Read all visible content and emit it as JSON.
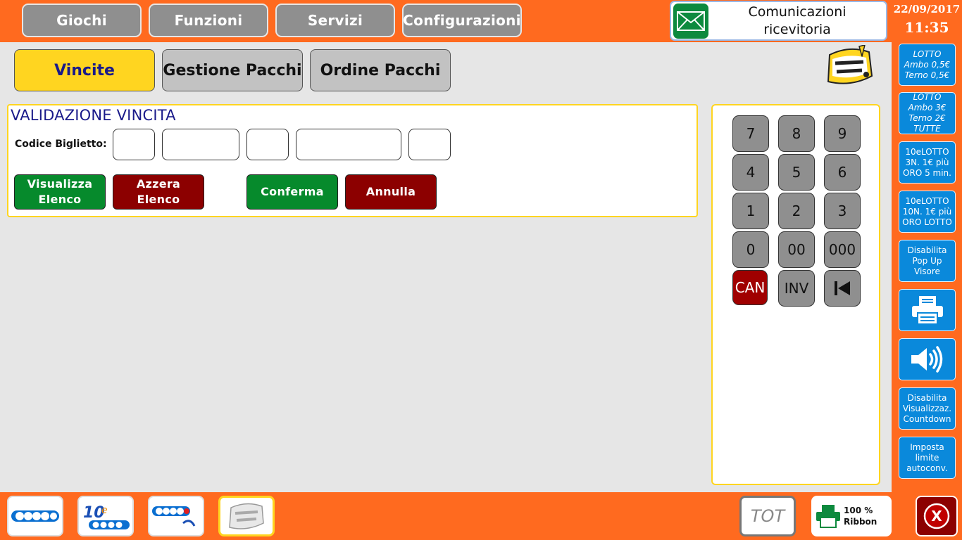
{
  "top_nav": {
    "items": [
      {
        "label": "Giochi"
      },
      {
        "label": "Funzioni"
      },
      {
        "label": "Servizi"
      },
      {
        "label": "Configurazioni"
      }
    ]
  },
  "communications": {
    "line1": "Comunicazioni",
    "line2": "ricevitoria",
    "icon": "envelope-icon"
  },
  "clock": {
    "date": "22/09/2017",
    "time": "11:35"
  },
  "tabs": [
    {
      "label": "Vincite",
      "active": true
    },
    {
      "label": "Gestione Pacchi",
      "active": false
    },
    {
      "label": "Ordine Pacchi",
      "active": false
    }
  ],
  "validation": {
    "title": "VALIDAZIONE VINCITA",
    "code_label": "Codice Biglietto:",
    "fields": [
      "",
      "",
      "",
      "",
      ""
    ],
    "buttons": {
      "show_list_l1": "Visualizza",
      "show_list_l2": "Elenco",
      "reset_list_l1": "Azzera",
      "reset_list_l2": "Elenco",
      "confirm": "Conferma",
      "cancel": "Annulla"
    }
  },
  "keypad": {
    "keys": [
      "7",
      "8",
      "9",
      "4",
      "5",
      "6",
      "1",
      "2",
      "3",
      "0",
      "00",
      "000",
      "CAN",
      "INV"
    ]
  },
  "sidebar": {
    "lotto1": [
      "LOTTO",
      "Ambo 0,5€",
      "Terno 0,5€"
    ],
    "lotto2": [
      "LOTTO",
      "Ambo 3€",
      "Terno 2€",
      "TUTTE"
    ],
    "dieci1": [
      "10eLOTTO",
      "3N. 1€ più",
      "ORO 5 min."
    ],
    "dieci2": [
      "10eLOTTO",
      "10N. 1€ più",
      "ORO LOTTO"
    ],
    "popup": [
      "Disabilita",
      "Pop Up",
      "Visore"
    ],
    "countdown": [
      "Disabilita",
      "Visualizzaz.",
      "Countdown"
    ],
    "limit": [
      "Imposta",
      "limite",
      "autoconv."
    ]
  },
  "bottom": {
    "tot": "TOT",
    "ribbon_pct": "100 %",
    "ribbon_label": "Ribbon",
    "close": "X"
  },
  "colors": {
    "orange": "#ff6a1f",
    "accent_yellow": "#ffd520",
    "sidebar_blue": "#0a89db",
    "green": "#068a2c",
    "dark_red": "#8c0000"
  }
}
